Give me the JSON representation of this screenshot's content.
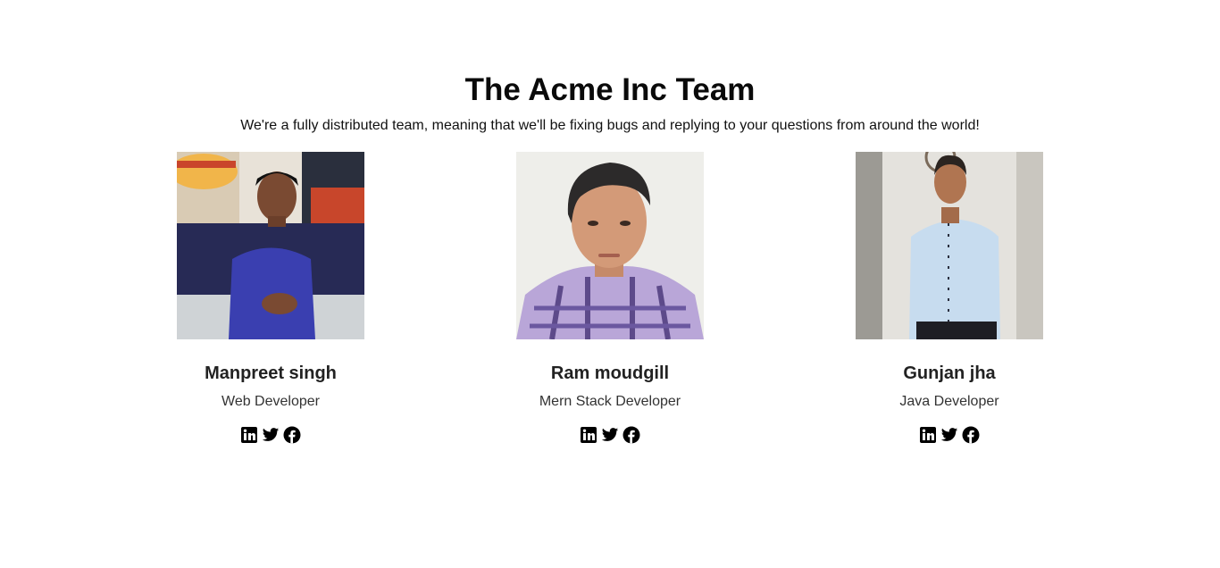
{
  "header": {
    "title": "The Acme Inc Team",
    "subtitle": "We're a fully distributed team, meaning that we'll be fixing bugs and replying to your questions from around the world!"
  },
  "members": [
    {
      "name": "Manpreet singh",
      "role": "Web Developer",
      "socials": [
        "linkedin-icon",
        "twitter-icon",
        "facebook-icon"
      ]
    },
    {
      "name": "Ram moudgill",
      "role": "Mern Stack Developer",
      "socials": [
        "linkedin-icon",
        "twitter-icon",
        "facebook-icon"
      ]
    },
    {
      "name": "Gunjan jha",
      "role": "Java Developer",
      "socials": [
        "linkedin-icon",
        "twitter-icon",
        "facebook-icon"
      ]
    }
  ],
  "colors": {
    "background": "#ffffff",
    "text": "#111111",
    "icon": "#000000"
  }
}
